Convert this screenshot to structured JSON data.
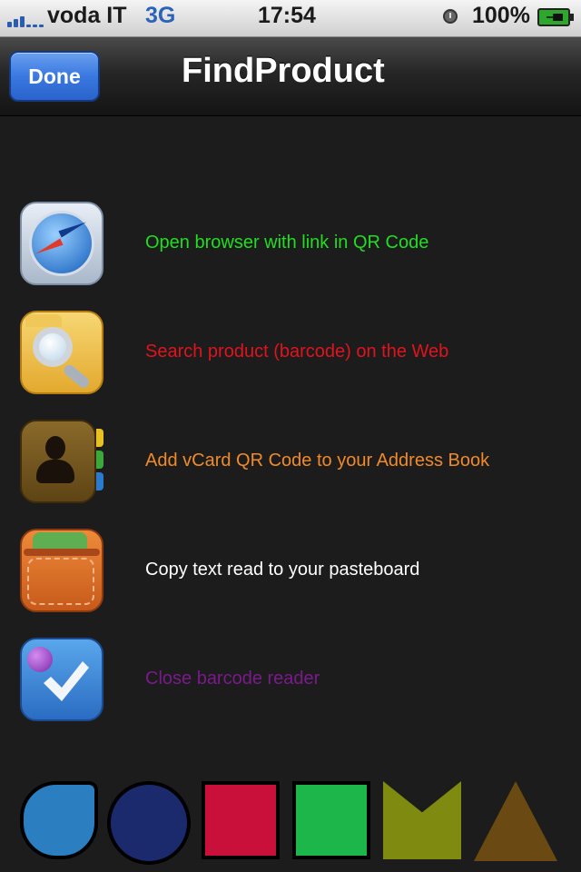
{
  "status_bar": {
    "carrier": "voda IT",
    "network": "3G",
    "time": "17:54",
    "battery": "100%"
  },
  "navbar": {
    "done_label": "Done",
    "title": "FindProduct"
  },
  "actions": [
    {
      "label": "Open browser with link in QR Code",
      "color": "#22dd22",
      "icon": "compass-icon"
    },
    {
      "label": "Search product (barcode) on the Web",
      "color": "#e0141e",
      "icon": "search-folder-icon"
    },
    {
      "label": "Add vCard QR Code to your Address Book",
      "color": "#f08a2a",
      "icon": "address-book-icon"
    },
    {
      "label": "Copy text read to your pasteboard",
      "color": "#ffffff",
      "icon": "wallet-icon"
    },
    {
      "label": "Close barcode reader",
      "color": "#7a1a8c",
      "icon": "checkmark-icon"
    }
  ],
  "logo": {
    "colors": [
      "#2b7fc0",
      "#1a2a6c",
      "#c8103a",
      "#1db64a",
      "#7f8a10",
      "#6a4a12"
    ]
  }
}
